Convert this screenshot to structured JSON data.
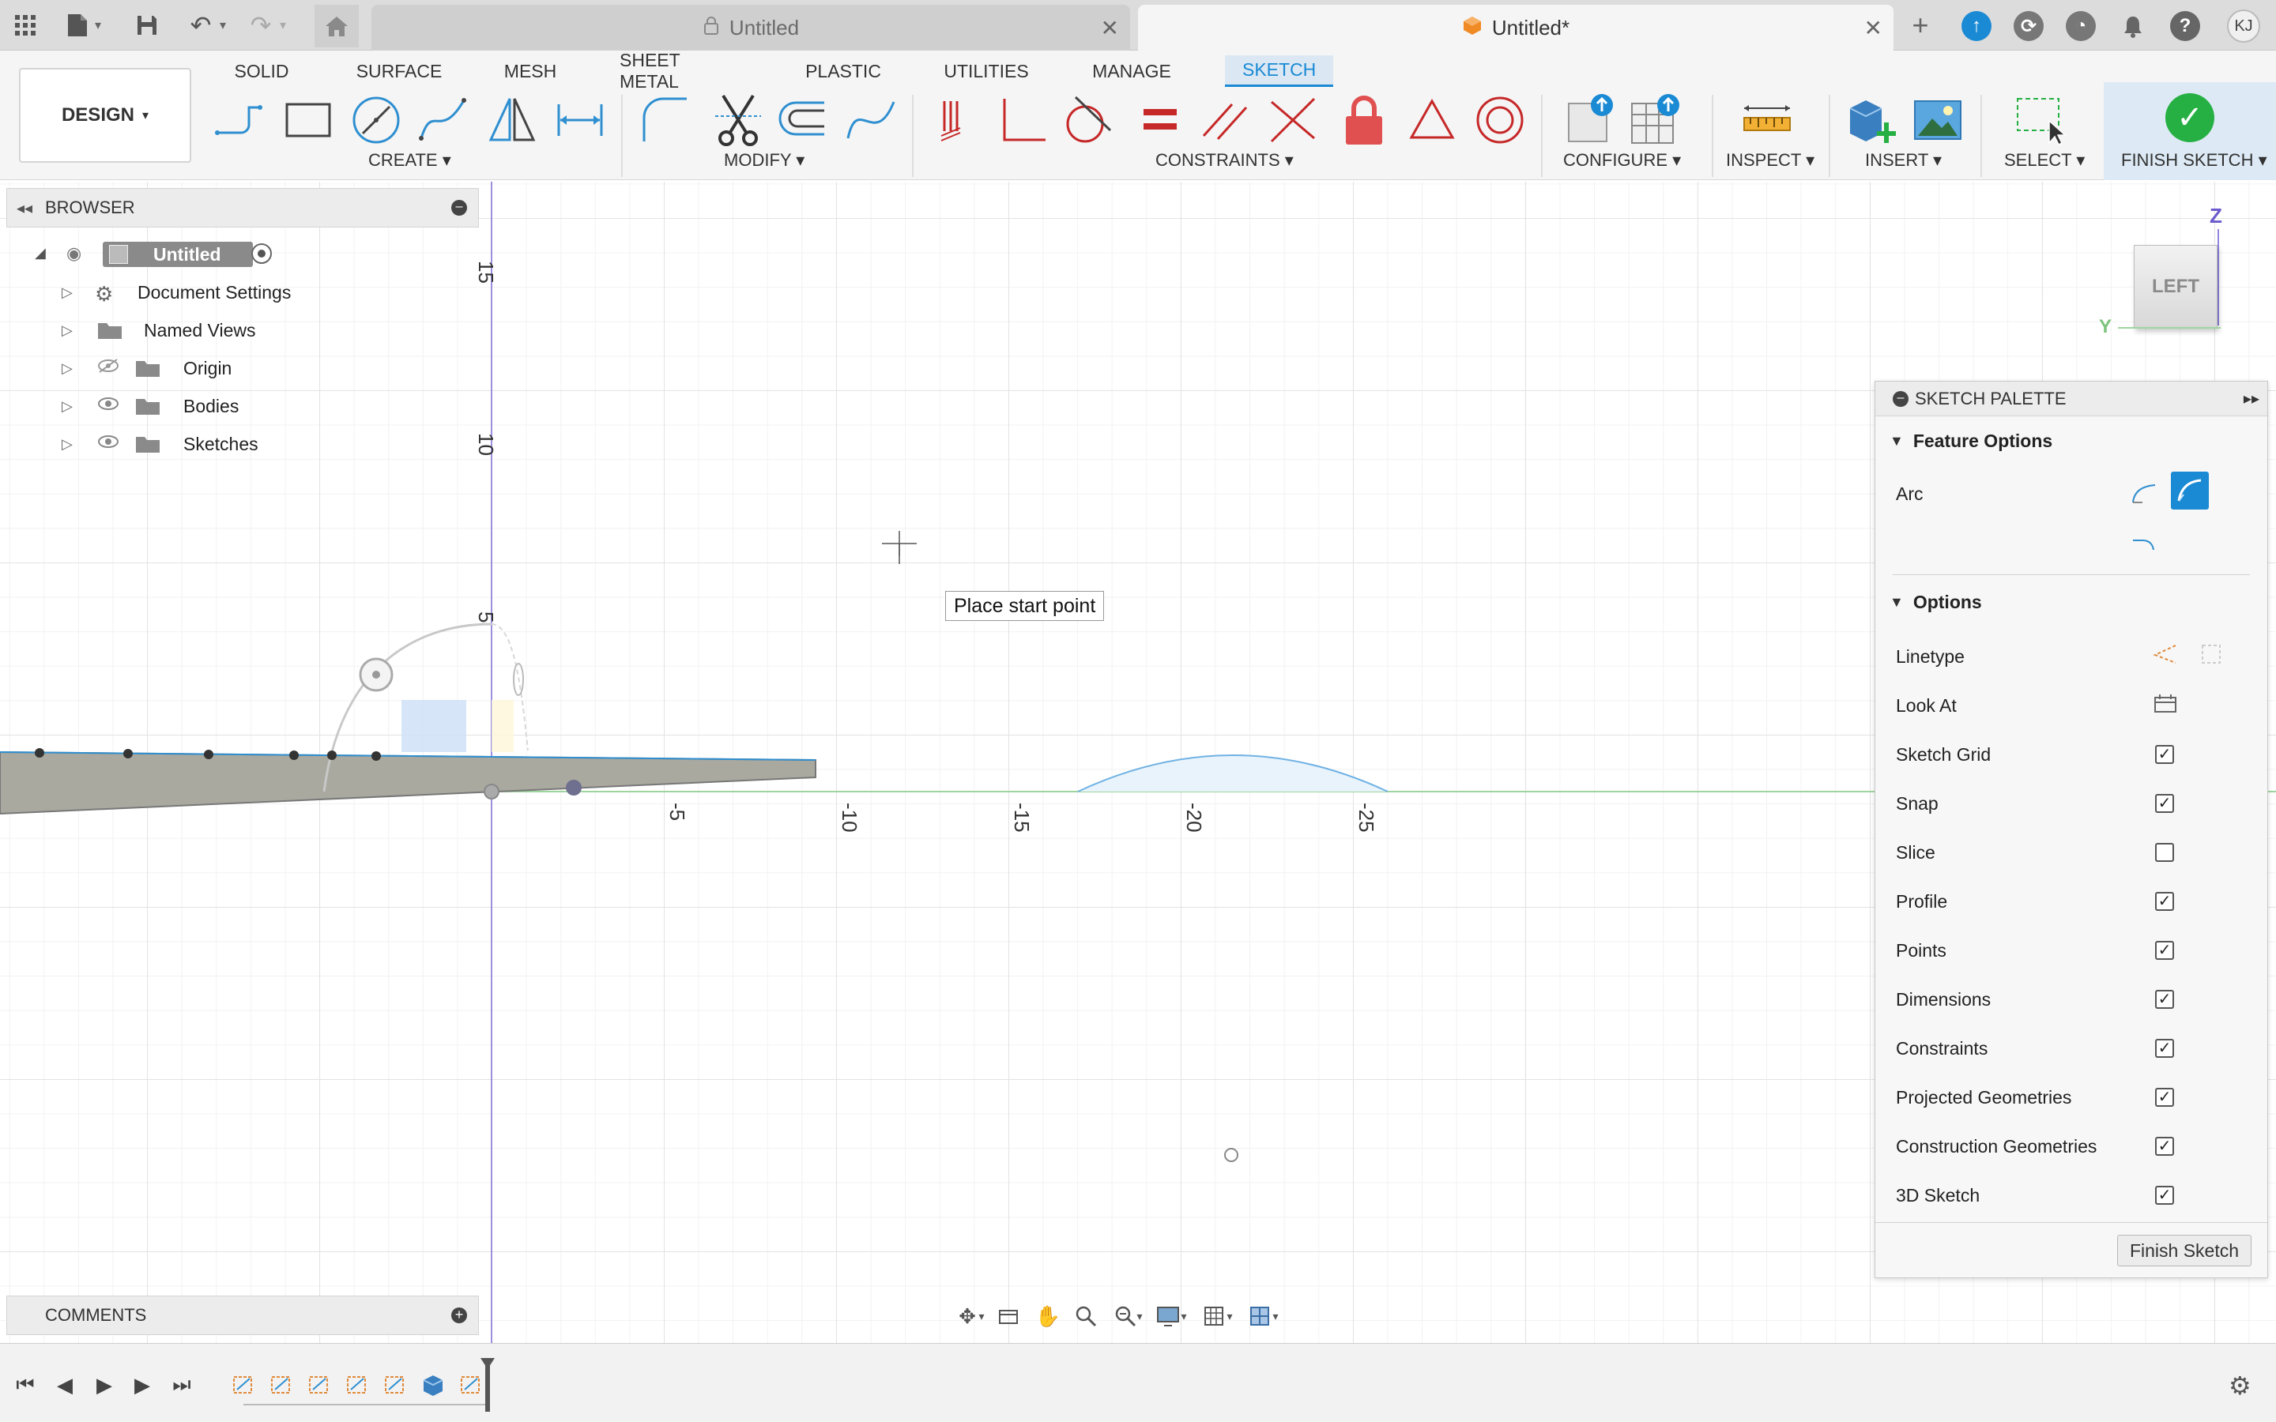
{
  "tabbar": {
    "doc_tab_inactive": "Untitled",
    "doc_tab_active": "Untitled*",
    "avatar_initials": "KJ",
    "icons": [
      "apps-grid-icon",
      "file-icon",
      "save-icon",
      "undo-icon",
      "redo-icon",
      "home-icon",
      "lock-icon",
      "close-icon",
      "new-tab-icon",
      "extensions-icon",
      "refresh-sync-icon",
      "job-status-icon",
      "notifications-bell-icon",
      "help-icon"
    ]
  },
  "workspace_tabs": [
    "SOLID",
    "SURFACE",
    "MESH",
    "SHEET METAL",
    "PLASTIC",
    "UTILITIES",
    "MANAGE",
    "SKETCH"
  ],
  "active_workspace_tab": "SKETCH",
  "design_button": "DESIGN",
  "toolbar_groups": {
    "create": "CREATE",
    "modify": "MODIFY",
    "constraints": "CONSTRAINTS",
    "configure": "CONFIGURE",
    "inspect": "INSPECT",
    "insert": "INSERT",
    "select": "SELECT",
    "finish": "FINISH SKETCH"
  },
  "browser": {
    "title": "BROWSER",
    "root": "Untitled",
    "items": [
      {
        "label": "Document Settings",
        "icon": "gear-icon"
      },
      {
        "label": "Named Views",
        "icon": "folder-icon"
      },
      {
        "label": "Origin",
        "icon": "folder-icon"
      },
      {
        "label": "Bodies",
        "icon": "folder-icon"
      },
      {
        "label": "Sketches",
        "icon": "folder-icon"
      }
    ]
  },
  "comments": {
    "title": "COMMENTS"
  },
  "tooltip": "Place start point",
  "viewcube": {
    "face": "LEFT",
    "axis_z": "Z",
    "axis_y": "Y"
  },
  "axis_ticks": {
    "vertical": [
      "15",
      "10",
      "5"
    ],
    "horizontal": [
      "-5",
      "-10",
      "-15",
      "-20",
      "-25"
    ]
  },
  "palette": {
    "title": "SKETCH PALETTE",
    "feature_options": "Feature Options",
    "arc_label": "Arc",
    "options": "Options",
    "rows": [
      {
        "label": "Linetype",
        "type": "icon"
      },
      {
        "label": "Look At",
        "type": "icon"
      },
      {
        "label": "Sketch Grid",
        "checked": true
      },
      {
        "label": "Snap",
        "checked": true
      },
      {
        "label": "Slice",
        "checked": false
      },
      {
        "label": "Profile",
        "checked": true
      },
      {
        "label": "Points",
        "checked": true
      },
      {
        "label": "Dimensions",
        "checked": true
      },
      {
        "label": "Constraints",
        "checked": true
      },
      {
        "label": "Projected Geometries",
        "checked": true
      },
      {
        "label": "Construction Geometries",
        "checked": true
      },
      {
        "label": "3D Sketch",
        "checked": true
      }
    ],
    "finish_button": "Finish Sketch"
  },
  "colors": {
    "accent": "#1a8ad4",
    "finish_green": "#26b043",
    "sketch_line": "#2f8fd0",
    "body_gray": "#a9a9a0"
  }
}
